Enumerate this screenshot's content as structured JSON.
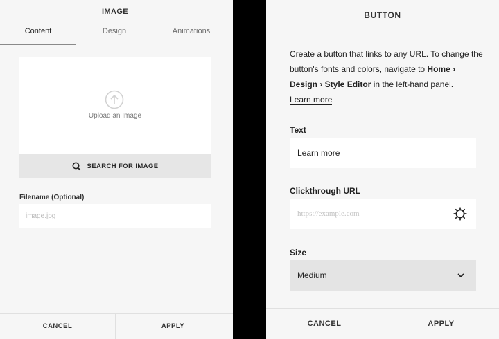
{
  "image_panel": {
    "title": "IMAGE",
    "tabs": [
      {
        "label": "Content",
        "active": true
      },
      {
        "label": "Design",
        "active": false
      },
      {
        "label": "Animations",
        "active": false
      }
    ],
    "upload": {
      "label": "Upload an Image",
      "icon": "upload-arrow-icon"
    },
    "search_button": {
      "label": "SEARCH FOR IMAGE",
      "icon": "search-icon"
    },
    "filename": {
      "label": "Filename (Optional)",
      "placeholder": "image.jpg",
      "value": ""
    },
    "footer": {
      "cancel": "CANCEL",
      "apply": "APPLY"
    }
  },
  "button_panel": {
    "title": "BUTTON",
    "description": {
      "part1": "Create a button that links to any URL. To change the button's fonts and colors, navigate to ",
      "bold": "Home › Design › Style Editor",
      "part2": " in the left-hand panel.",
      "link": "Learn more"
    },
    "text_field": {
      "label": "Text",
      "value": "Learn more"
    },
    "url_field": {
      "label": "Clickthrough URL",
      "placeholder": "https://example.com",
      "value": "",
      "icon": "gear-icon"
    },
    "size_field": {
      "label": "Size",
      "value": "Medium",
      "icon": "chevron-down-icon"
    },
    "footer": {
      "cancel": "CANCEL",
      "apply": "APPLY"
    }
  },
  "colors": {
    "panel_bg": "#f6f6f6",
    "backdrop": "#000000",
    "search_button_bg": "#e6e6e6",
    "select_bg": "#e4e4e4"
  }
}
